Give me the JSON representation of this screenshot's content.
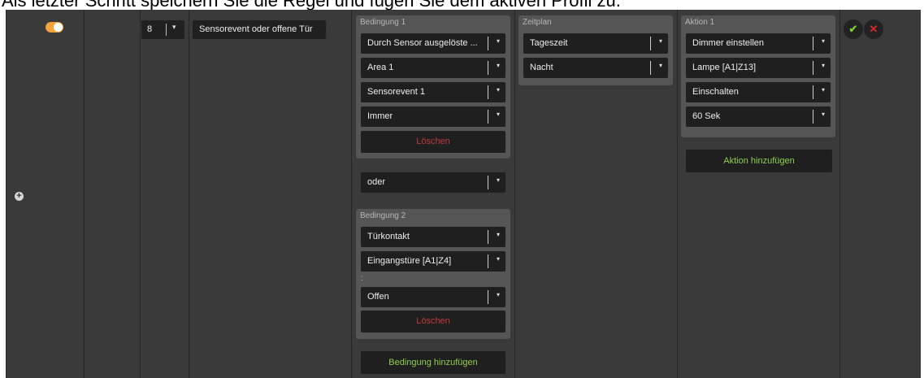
{
  "instruction": "Als letzter Schritt speichern Sie die Regel und fügen Sie dem aktiven Profil zu.",
  "rule": {
    "priority": "8",
    "name": "Sensorevent oder offene Tür"
  },
  "conditions": [
    {
      "title": "Bedingung 1",
      "dropdowns": [
        "Durch Sensor ausgelöste ...",
        "Area 1",
        "Sensorevent 1",
        "Immer"
      ],
      "delete_label": "Löschen"
    },
    {
      "title": "Bedingung 2",
      "dropdowns": [
        "Türkontakt",
        "Eingangstüre [A1|Z4]",
        "Offen"
      ],
      "separator": ":",
      "delete_label": "Löschen"
    }
  ],
  "operator": "oder",
  "add_condition_label": "Bedingung hinzufügen",
  "schedule": {
    "title": "Zeitplan",
    "dropdowns": [
      "Tageszeit",
      "Nacht"
    ]
  },
  "actions": [
    {
      "title": "Aktion 1",
      "dropdowns": [
        "Dimmer einstellen",
        "Lampe [A1|Z13]",
        "Einschalten",
        "60 Sek"
      ]
    }
  ],
  "add_action_label": "Aktion hinzufügen",
  "icons": {
    "toggle": "toggle-icon",
    "add_rule": "plus-icon",
    "dropdown": "caret-down-icon",
    "confirm": "check-icon",
    "cancel": "close-icon"
  },
  "glyphs": {
    "plus": "+",
    "caret": "▾",
    "check": "✔",
    "cross": "✕"
  },
  "colors": {
    "toggle_on": "#f2a33a",
    "accent_green": "#8fd14a",
    "delete_red": "#c0393b",
    "panel_bg": "#3a3a3a",
    "group_bg": "#555555"
  }
}
